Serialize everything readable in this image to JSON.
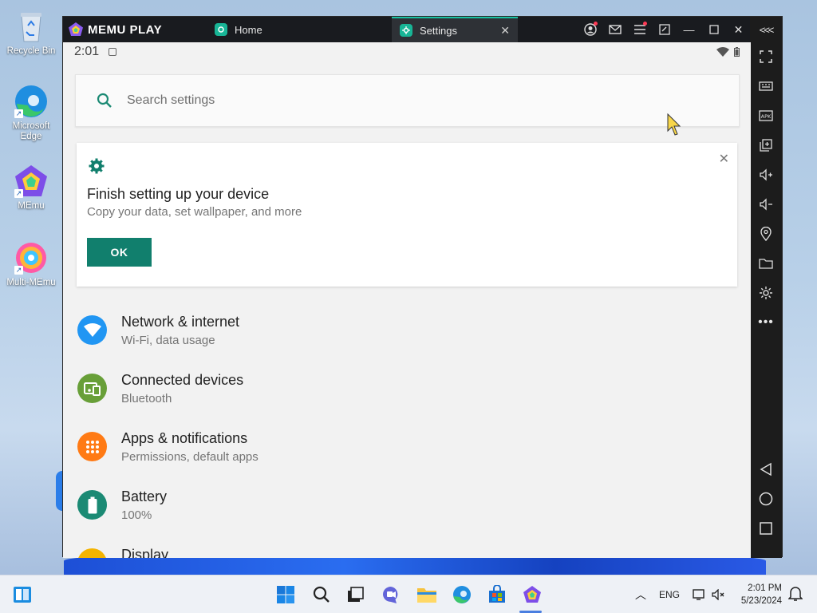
{
  "desktop": {
    "icons": [
      {
        "label": "Recycle Bin"
      },
      {
        "label": "Microsoft Edge"
      },
      {
        "label": "MEmu"
      },
      {
        "label": "Multi-MEmu"
      }
    ]
  },
  "emulator": {
    "brand": "MEMU PLAY",
    "tabs": [
      {
        "label": "Home"
      },
      {
        "label": "Settings"
      }
    ],
    "colors": {
      "accent": "#16c2a3",
      "titlebar": "#191b1f"
    }
  },
  "android": {
    "status": {
      "time": "2:01"
    },
    "search": {
      "placeholder": "Search settings"
    },
    "card": {
      "title": "Finish setting up your device",
      "subtitle": "Copy your data, set wallpaper, and more",
      "ok_label": "OK"
    },
    "items": [
      {
        "title": "Network & internet",
        "subtitle": "Wi-Fi, data usage",
        "icon": "wifi-icon",
        "color": "#2196f3"
      },
      {
        "title": "Connected devices",
        "subtitle": "Bluetooth",
        "icon": "devices-icon",
        "color": "#689f38"
      },
      {
        "title": "Apps & notifications",
        "subtitle": "Permissions, default apps",
        "icon": "apps-icon",
        "color": "#ff7a14"
      },
      {
        "title": "Battery",
        "subtitle": "100%",
        "icon": "battery-icon",
        "color": "#1b8a74"
      },
      {
        "title": "Display",
        "subtitle": "",
        "icon": "display-icon",
        "color": "#f4b400"
      }
    ],
    "colors": {
      "primary": "#117f6d",
      "search_icon": "#1b8a74"
    }
  },
  "taskbar": {
    "language": "ENG",
    "time": "2:01 PM",
    "date": "5/23/2024"
  }
}
